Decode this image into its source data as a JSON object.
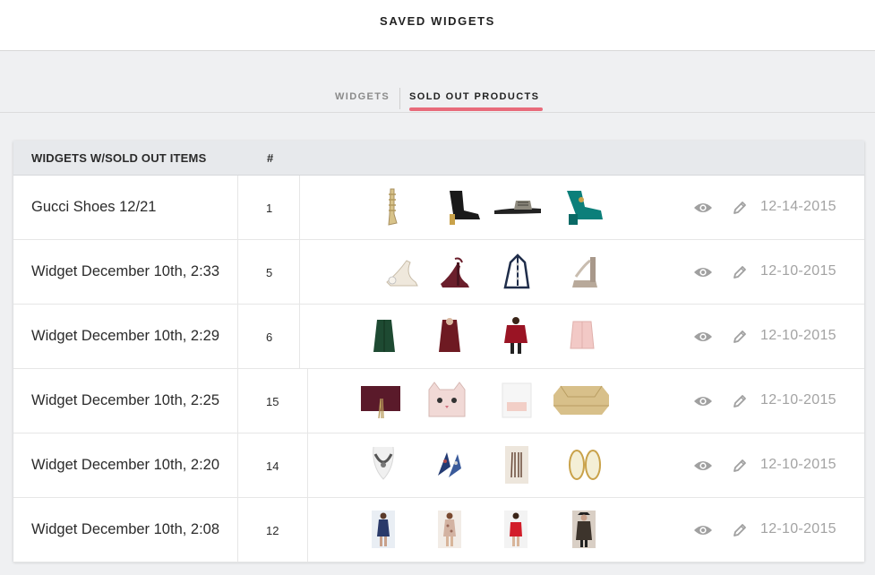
{
  "header": {
    "title": "SAVED WIDGETS"
  },
  "tabs": [
    {
      "label": "WIDGETS",
      "active": false
    },
    {
      "label": "SOLD OUT PRODUCTS",
      "active": true
    }
  ],
  "colors": {
    "accent": "#e86b7b",
    "date_text": "#a3a3a3",
    "icon": "#a0a0a0"
  },
  "table": {
    "columns": [
      "WIDGETS W/SOLD OUT ITEMS",
      "#"
    ],
    "rows": [
      {
        "name": "Gucci Shoes 12/21",
        "count": "1",
        "date": "12-14-2015",
        "products": [
          "gold-gladiator-sandal",
          "black-ankle-boot",
          "black-slide-sandal",
          "teal-pump"
        ]
      },
      {
        "name": "Widget December 10th, 2:33",
        "count": "5",
        "date": "12-10-2015",
        "products": [
          "embellished-white-pump",
          "burgundy-ankle-strap-pump",
          "navy-t-strap-sandal",
          "metallic-platform-sandal"
        ]
      },
      {
        "name": "Widget December 10th, 2:29",
        "count": "6",
        "date": "12-10-2015",
        "products": [
          "green-fur-coat",
          "burgundy-fur-coat",
          "red-fur-jacket",
          "pink-fur-jacket"
        ]
      },
      {
        "name": "Widget December 10th, 2:25",
        "count": "15",
        "date": "12-10-2015",
        "products": [
          "burgundy-tassel-clutch",
          "cat-face-clutch",
          "blush-clutch",
          "gold-minaudiere"
        ]
      },
      {
        "name": "Widget December 10th, 2:20",
        "count": "14",
        "date": "12-10-2015",
        "products": [
          "statement-necklace",
          "jeweled-earrings",
          "tassel-earrings",
          "gold-drop-earrings"
        ]
      },
      {
        "name": "Widget December 10th, 2:08",
        "count": "12",
        "date": "12-10-2015",
        "products": [
          "sequin-mini-dress",
          "printed-mini-dress",
          "red-bandeau-dress",
          "sequin-jacket-look"
        ]
      }
    ]
  }
}
